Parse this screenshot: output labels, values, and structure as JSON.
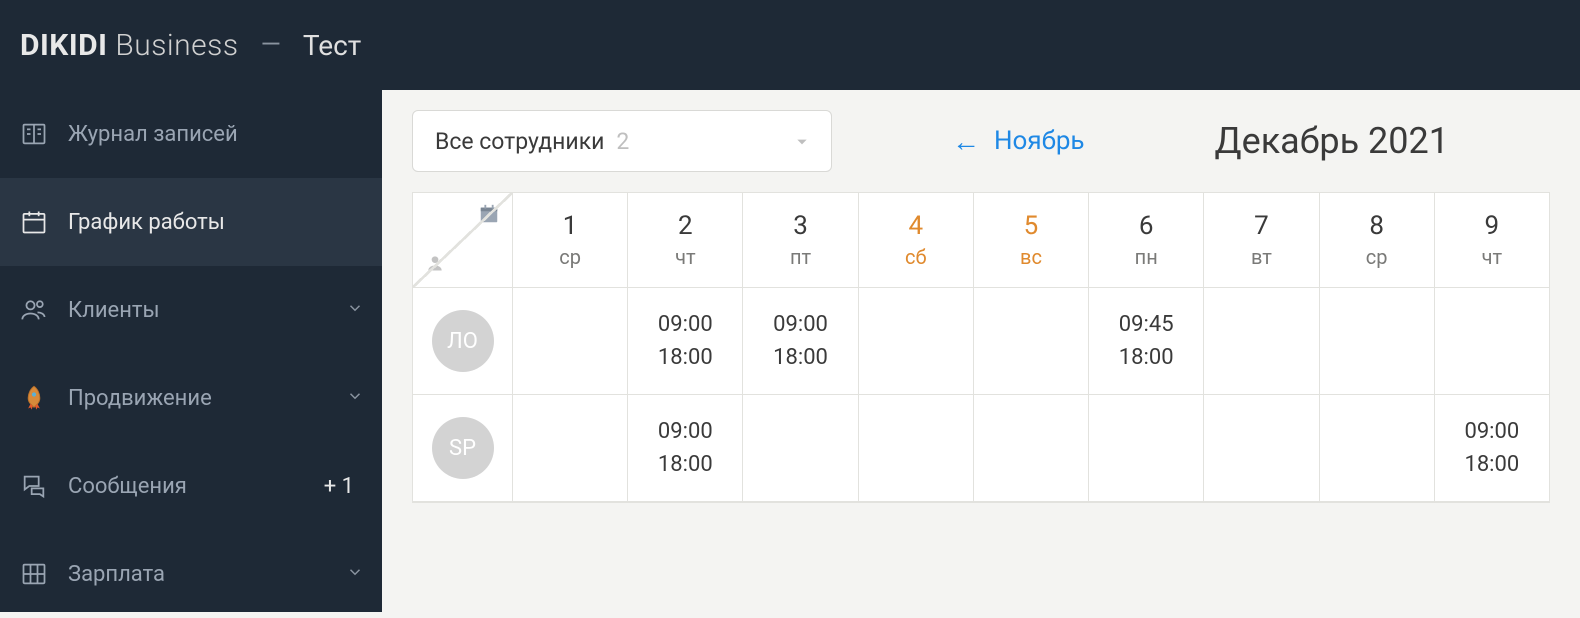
{
  "header": {
    "brand_bold": "DIKIDI",
    "brand_light": "Business",
    "separator": "—",
    "project": "Тест"
  },
  "sidebar": {
    "items": [
      {
        "label": "Журнал записей",
        "icon": "journal",
        "active": false,
        "chevron": false
      },
      {
        "label": "График работы",
        "icon": "calendar",
        "active": true,
        "chevron": false
      },
      {
        "label": "Клиенты",
        "icon": "clients",
        "active": false,
        "chevron": true
      },
      {
        "label": "Продвижение",
        "icon": "rocket",
        "active": false,
        "chevron": true
      },
      {
        "label": "Сообщения",
        "icon": "messages",
        "active": false,
        "chevron": false,
        "badge": "+ 1"
      },
      {
        "label": "Зарплата",
        "icon": "salary",
        "active": false,
        "chevron": true
      }
    ]
  },
  "toolbar": {
    "select_label": "Все сотрудники",
    "select_count": "2",
    "prev_month": "Ноябрь",
    "current_month": "Декабрь 2021"
  },
  "schedule": {
    "days": [
      {
        "num": "1",
        "name": "ср",
        "weekend": false
      },
      {
        "num": "2",
        "name": "чт",
        "weekend": false
      },
      {
        "num": "3",
        "name": "пт",
        "weekend": false
      },
      {
        "num": "4",
        "name": "сб",
        "weekend": true
      },
      {
        "num": "5",
        "name": "вс",
        "weekend": true
      },
      {
        "num": "6",
        "name": "пн",
        "weekend": false
      },
      {
        "num": "7",
        "name": "вт",
        "weekend": false
      },
      {
        "num": "8",
        "name": "ср",
        "weekend": false
      },
      {
        "num": "9",
        "name": "чт",
        "weekend": false
      }
    ],
    "employees": [
      {
        "initials": "ЛО",
        "slots": [
          {
            "start": "",
            "end": ""
          },
          {
            "start": "09:00",
            "end": "18:00"
          },
          {
            "start": "09:00",
            "end": "18:00"
          },
          {
            "start": "",
            "end": ""
          },
          {
            "start": "",
            "end": ""
          },
          {
            "start": "09:45",
            "end": "18:00"
          },
          {
            "start": "",
            "end": ""
          },
          {
            "start": "",
            "end": ""
          },
          {
            "start": "",
            "end": ""
          }
        ]
      },
      {
        "initials": "SP",
        "slots": [
          {
            "start": "",
            "end": ""
          },
          {
            "start": "09:00",
            "end": "18:00"
          },
          {
            "start": "",
            "end": ""
          },
          {
            "start": "",
            "end": ""
          },
          {
            "start": "",
            "end": ""
          },
          {
            "start": "",
            "end": ""
          },
          {
            "start": "",
            "end": ""
          },
          {
            "start": "",
            "end": ""
          },
          {
            "start": "09:00",
            "end": "18:00"
          }
        ]
      }
    ]
  }
}
